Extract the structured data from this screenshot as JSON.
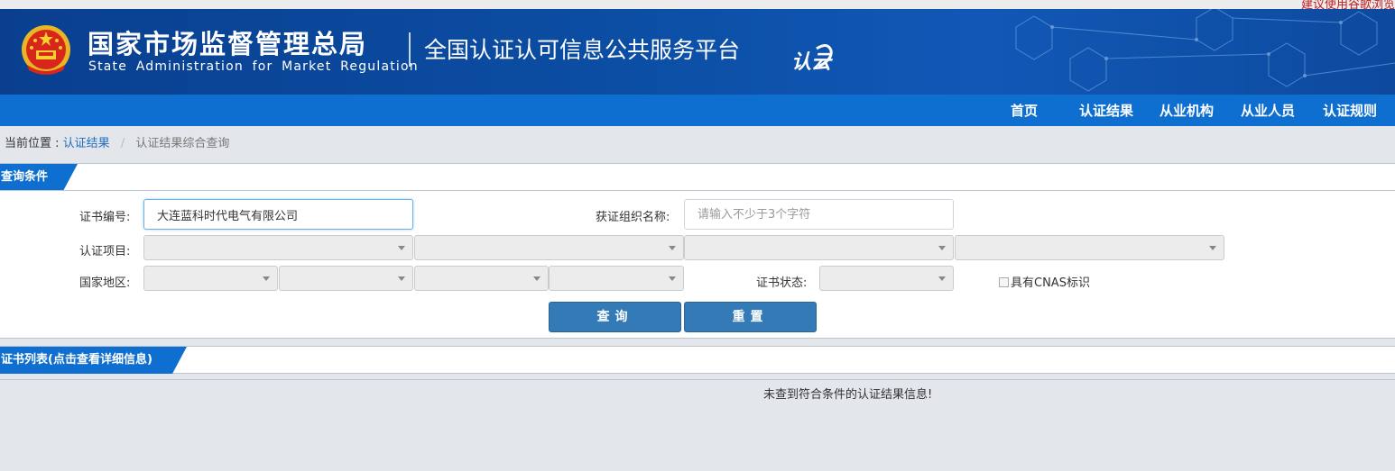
{
  "notice": "建议使用谷歌浏览",
  "header": {
    "agency_cn": "国家市场监督管理总局",
    "agency_en": "State Administration for Market Regulation",
    "platform": "全国认证认可信息公共服务平台",
    "logo_text": "认云"
  },
  "nav": [
    "首页",
    "认证结果",
    "从业机构",
    "从业人员",
    "认证规则"
  ],
  "breadcrumb": {
    "label": "当前位置 :",
    "link": "认证结果",
    "sep": "/",
    "current": "认证结果综合查询"
  },
  "query": {
    "title": "查询条件",
    "cert_no_label": "证书编号:",
    "cert_no_value": "大连蓝科时代电气有限公司",
    "org_label": "获证组织名称:",
    "org_placeholder": "请输入不少于3个字符",
    "project_label": "认证项目:",
    "region_label": "国家地区:",
    "status_label": "证书状态:",
    "cnas_label": "具有CNAS标识",
    "search_button": "查询",
    "reset_button": "重置"
  },
  "results": {
    "title": "证书列表(点击查看详细信息)",
    "empty_message": "未查到符合条件的认证结果信息!"
  },
  "colors": {
    "banner": "#0b4ea4",
    "nav": "#0e6fd0",
    "button": "#337ab7",
    "link": "#1f6fbf",
    "notice": "#c41a1a"
  }
}
